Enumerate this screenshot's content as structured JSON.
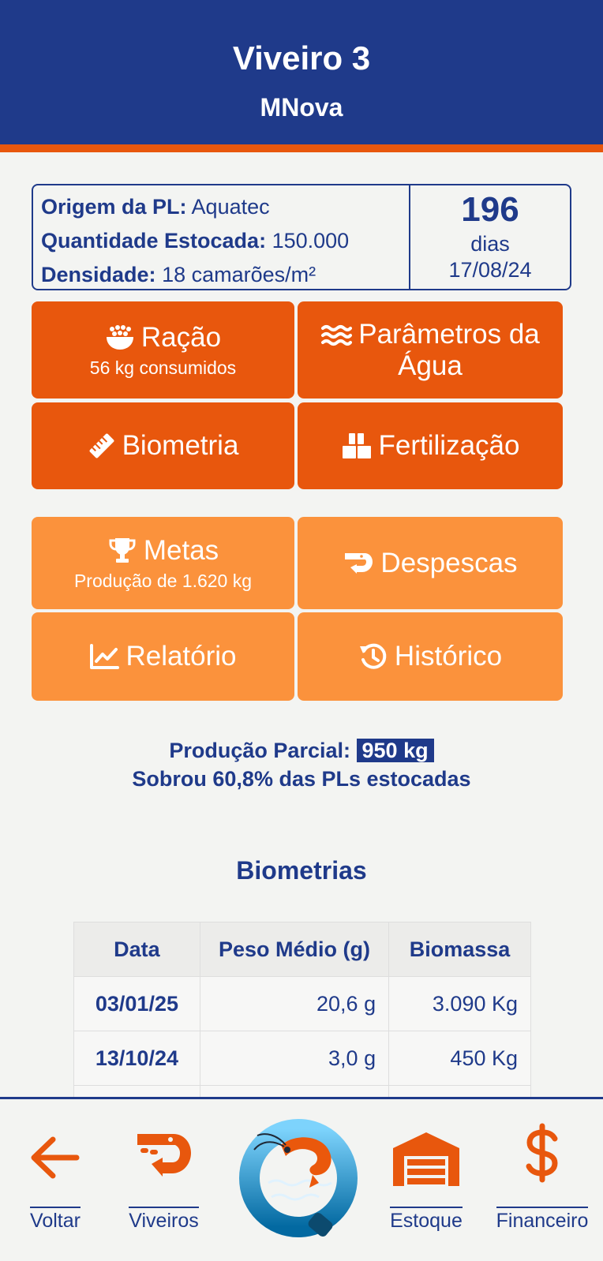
{
  "header": {
    "title": "Viveiro 3",
    "subtitle": "MNova"
  },
  "info": {
    "origin_label": "Origem da PL:",
    "origin_value": "Aquatec",
    "quantity_label": "Quantidade Estocada:",
    "quantity_value": "150.000",
    "density_label": "Densidade:",
    "density_value": "18 camarões/m²",
    "days_number": "196",
    "days_label": "dias",
    "date": "17/08/24"
  },
  "tiles": {
    "racao": {
      "label": "Ração",
      "sub": "56 kg consumidos",
      "icon": "feed-bowl-icon"
    },
    "parametros": {
      "label": "Parâmetros da Água",
      "icon": "water-waves-icon"
    },
    "biometria": {
      "label": "Biometria",
      "icon": "ruler-icon"
    },
    "fertilizacao": {
      "label": "Fertilização",
      "icon": "boxes-icon"
    },
    "metas": {
      "label": "Metas",
      "sub": "Produção de 1.620 kg",
      "icon": "trophy-icon"
    },
    "despescas": {
      "label": "Despescas",
      "icon": "shrimp-icon"
    },
    "relatorio": {
      "label": "Relatório",
      "icon": "line-chart-icon"
    },
    "historico": {
      "label": "Histórico",
      "icon": "history-icon"
    }
  },
  "summary": {
    "production_label": "Produção Parcial:",
    "production_value": "950 kg",
    "remaining": "Sobrou 60,8% das PLs estocadas"
  },
  "biometrias": {
    "title": "Biometrias",
    "columns": [
      "Data",
      "Peso Médio (g)",
      "Biomassa"
    ],
    "rows": [
      [
        "03/01/25",
        "20,6 g",
        "3.090 Kg"
      ],
      [
        "13/10/24",
        "3,0 g",
        "450 Kg"
      ],
      [
        "",
        "",
        ""
      ]
    ]
  },
  "nav": {
    "back": "Voltar",
    "ponds": "Viveiros",
    "stock": "Estoque",
    "finance": "Financeiro"
  },
  "colors": {
    "primary": "#1f3a8a",
    "accent_dark": "#e8570d",
    "accent_light": "#fb923c",
    "background": "#f3f4f2"
  }
}
